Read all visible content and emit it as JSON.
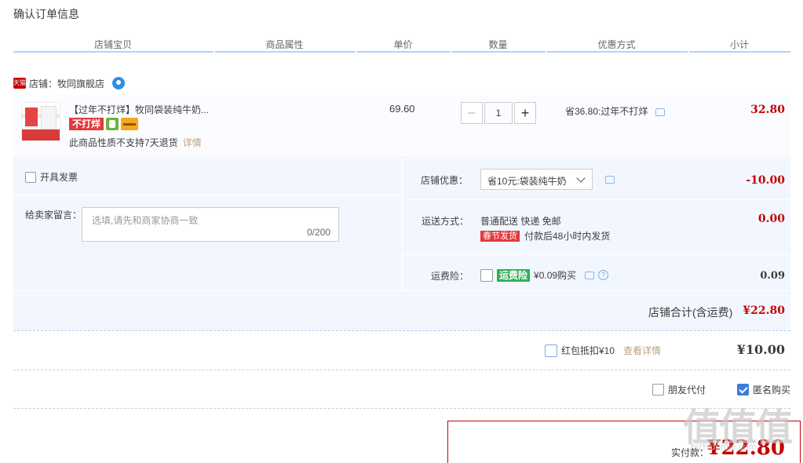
{
  "page_title": "确认订单信息",
  "columns": [
    "店铺宝贝",
    "商品属性",
    "单价",
    "数量",
    "优惠方式",
    "小计"
  ],
  "shop": {
    "badge": "天猫",
    "label": "店铺：牧同旗舰店"
  },
  "item": {
    "title": "【过年不打烊】牧同袋装纯牛奶...",
    "tag": "不打烊",
    "return_note": "此商品性质不支持7天退货",
    "return_detail": "详情",
    "unit_price": "69.60",
    "quantity": "1",
    "qty_minus": "−",
    "qty_plus": "+",
    "promo": "省36.80:过年不打烊",
    "subtotal": "32.80"
  },
  "invoice": {
    "label": "开具发票"
  },
  "message": {
    "label": "给卖家留言：",
    "placeholder": "选填,请先和商家协商一致",
    "count": "0/200"
  },
  "shop_discount": {
    "label": "店铺优惠：",
    "selected": "省10元:袋装纯牛奶",
    "amount": "-10.00"
  },
  "shipping": {
    "label": "运送方式：",
    "method": "普通配送 快递 免邮",
    "tag": "春节发货",
    "note": "付款后48小时内发货",
    "amount": "0.00"
  },
  "insurance": {
    "label": "运费险：",
    "tag": "运费险",
    "text": "¥0.09购买",
    "amount": "0.09"
  },
  "shop_total": {
    "label": "店铺合计(含运费)",
    "amount": "¥22.80"
  },
  "red_packet": {
    "label": "红包抵扣¥10",
    "detail": "查看详情",
    "amount": "¥10.00"
  },
  "options": {
    "friend_pay": "朋友代付",
    "anonymous": "匿名购买"
  },
  "pay": {
    "label": "实付款：",
    "amount": "¥22.80"
  },
  "watermark": {
    "text": "值值值",
    "sub": "hizhidemai.com"
  },
  "colors": {
    "accent_red": "#c40000",
    "light_blue_bg": "#f2f7ff",
    "header_line": "#b2d1ff"
  }
}
